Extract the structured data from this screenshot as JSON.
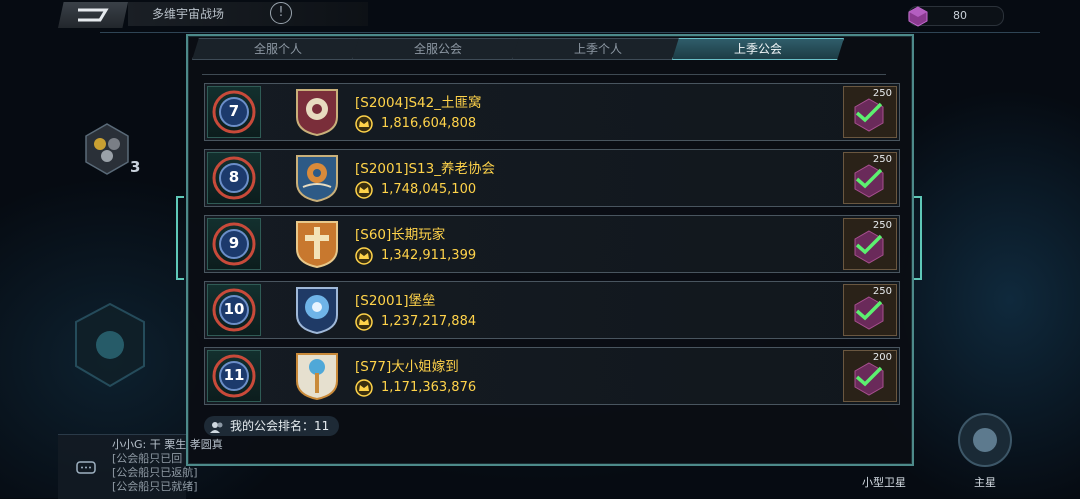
{
  "header": {
    "title": "多维宇宙战场",
    "info_icon": "info-icon",
    "back_icon": "back-arrow-icon",
    "resource": {
      "icon": "gem-cube-icon",
      "value": "80"
    }
  },
  "tabs": [
    {
      "label": "全服个人",
      "active": false
    },
    {
      "label": "全服公会",
      "active": false
    },
    {
      "label": "上季个人",
      "active": false
    },
    {
      "label": "上季公会",
      "active": true
    }
  ],
  "side": {
    "badge_count": "3"
  },
  "rows": [
    {
      "rank": "7",
      "name": "[S2004]S42_土匪窝",
      "score": "1,816,604,808",
      "reward_count": "250",
      "claimed": true
    },
    {
      "rank": "8",
      "name": "[S2001]S13_养老协会",
      "score": "1,748,045,100",
      "reward_count": "250",
      "claimed": true
    },
    {
      "rank": "9",
      "name": "[S60]长期玩家",
      "score": "1,342,911,399",
      "reward_count": "250",
      "claimed": true
    },
    {
      "rank": "10",
      "name": "[S2001]堡垒",
      "score": "1,237,217,884",
      "reward_count": "250",
      "claimed": true
    },
    {
      "rank": "11",
      "name": "[S77]大小姐嫁到",
      "score": "1,171,363,876",
      "reward_count": "200",
      "claimed": true
    }
  ],
  "my_rank": {
    "label": "我的公会排名：11"
  },
  "chat": {
    "lines": [
      "小小G: 干 栗生 孝圆真",
      "[公会船只已回",
      "[公会船只已返航]",
      "[公会船只已就绪]"
    ]
  },
  "bottom_nav": {
    "satellite_label": "小型卫星",
    "main_star_label": "主星"
  },
  "colors": {
    "accent": "#5fc8b8",
    "gold": "#ffd34a",
    "tab_active": "#2f5d6a"
  }
}
